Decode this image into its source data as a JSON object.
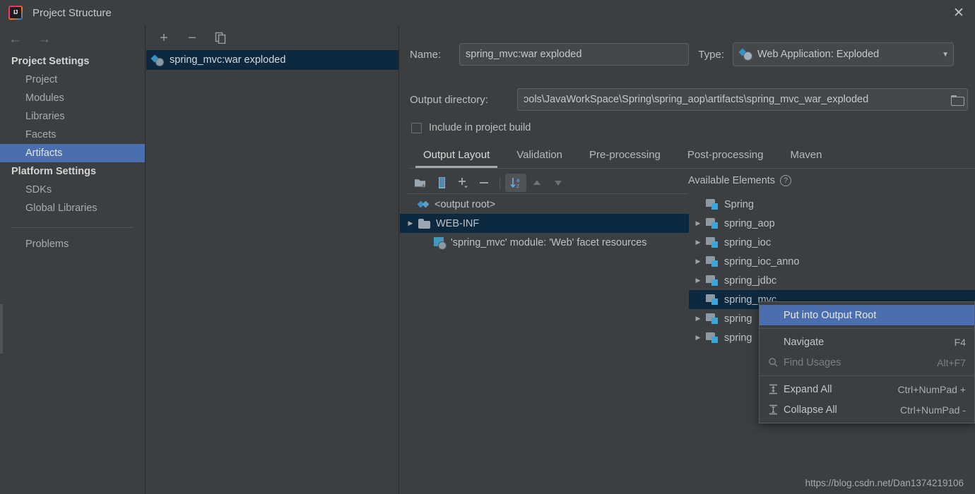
{
  "window": {
    "title": "Project Structure",
    "app_icon": "intellij-idea-logo",
    "close_icon": "✕"
  },
  "navigation": {
    "back_icon": "←",
    "forward_icon": "→"
  },
  "sidebar": {
    "groups": [
      {
        "label": "Project Settings",
        "items": [
          {
            "label": "Project",
            "selected": false
          },
          {
            "label": "Modules",
            "selected": false
          },
          {
            "label": "Libraries",
            "selected": false
          },
          {
            "label": "Facets",
            "selected": false
          },
          {
            "label": "Artifacts",
            "selected": true
          }
        ]
      },
      {
        "label": "Platform Settings",
        "items": [
          {
            "label": "SDKs",
            "selected": false
          },
          {
            "label": "Global Libraries",
            "selected": false
          }
        ]
      }
    ],
    "extra": {
      "label": "Problems"
    }
  },
  "artifacts_panel": {
    "toolbar": [
      {
        "name": "add-artifact-button",
        "glyph": "+"
      },
      {
        "name": "remove-artifact-button",
        "glyph": "−"
      },
      {
        "name": "copy-artifact-button",
        "glyph": "❐"
      }
    ],
    "items": [
      {
        "label": "spring_mvc:war exploded",
        "icon": "artifact-webapp-icon",
        "selected": true
      }
    ]
  },
  "details": {
    "name_label": "Name:",
    "name_value": "spring_mvc:war exploded",
    "type_label": "Type:",
    "type_value": "Web Application: Exploded",
    "type_icon": "web-application-icon",
    "type_caret": "▼",
    "output_dir_label": "Output directory:",
    "output_dir_value": "ɔols\\JavaWorkSpace\\Spring\\spring_aop\\artifacts\\spring_mvc_war_exploded",
    "browse_icon": "folder-browse-icon",
    "include_in_build_label": "Include in project build",
    "include_in_build_checked": false,
    "tabs": [
      {
        "label": "Output Layout",
        "active": true
      },
      {
        "label": "Validation",
        "active": false
      },
      {
        "label": "Pre-processing",
        "active": false
      },
      {
        "label": "Post-processing",
        "active": false
      },
      {
        "label": "Maven",
        "active": false
      }
    ]
  },
  "layout_toolbar": {
    "buttons": [
      {
        "name": "create-directory-button",
        "icon": "new-folder-icon",
        "active": false,
        "disabled": false
      },
      {
        "name": "create-archive-button",
        "icon": "archive-icon",
        "active": false,
        "disabled": false
      },
      {
        "name": "add-copy-of-button",
        "icon": "plus-dropdown-icon",
        "active": false,
        "disabled": false
      },
      {
        "name": "remove-element-button",
        "icon": "minus-icon",
        "active": false,
        "disabled": false
      },
      {
        "name": "sort-alphabetically-button",
        "icon": "sort-az-icon",
        "active": true,
        "disabled": false
      },
      {
        "name": "move-up-button",
        "icon": "arrow-up-icon",
        "active": false,
        "disabled": true
      },
      {
        "name": "move-down-button",
        "icon": "arrow-down-icon",
        "active": false,
        "disabled": true
      }
    ]
  },
  "output_tree": [
    {
      "label": "<output root>",
      "icon": "output-root-icon",
      "indent": 0,
      "twisty": "",
      "selected": false
    },
    {
      "label": "WEB-INF",
      "icon": "folder-icon",
      "indent": 0,
      "twisty": "▶",
      "selected": true
    },
    {
      "label": "'spring_mvc' module: 'Web' facet resources",
      "icon": "web-facet-icon",
      "indent": 1,
      "twisty": "",
      "selected": false
    }
  ],
  "available_elements": {
    "header": "Available Elements",
    "help_icon": "?",
    "items": [
      {
        "label": "Spring",
        "twisty": "",
        "selected": false
      },
      {
        "label": "spring_aop",
        "twisty": "▶",
        "selected": false
      },
      {
        "label": "spring_ioc",
        "twisty": "▶",
        "selected": false
      },
      {
        "label": "spring_ioc_anno",
        "twisty": "▶",
        "selected": false
      },
      {
        "label": "spring_jdbc",
        "twisty": "▶",
        "selected": false
      },
      {
        "label": "spring_mvc",
        "twisty": "",
        "selected": true
      },
      {
        "label": "spring",
        "twisty": "▶",
        "selected": false
      },
      {
        "label": "spring",
        "twisty": "▶",
        "selected": false
      }
    ]
  },
  "context_menu": {
    "items": [
      {
        "label": "Put into Output Root",
        "shortcut": "",
        "icon": "",
        "highlight": true,
        "disabled": false,
        "separator_after": true
      },
      {
        "label": "Navigate",
        "shortcut": "F4",
        "icon": "",
        "highlight": false,
        "disabled": false,
        "separator_after": false
      },
      {
        "label": "Find Usages",
        "shortcut": "Alt+F7",
        "icon": "search-icon",
        "highlight": false,
        "disabled": true,
        "separator_after": true
      },
      {
        "label": "Expand All",
        "shortcut": "Ctrl+NumPad +",
        "icon": "expand-all-icon",
        "highlight": false,
        "disabled": false,
        "separator_after": false
      },
      {
        "label": "Collapse All",
        "shortcut": "Ctrl+NumPad -",
        "icon": "collapse-all-icon",
        "highlight": false,
        "disabled": false,
        "separator_after": false
      }
    ]
  },
  "watermark": {
    "text": "https://blog.csdn.net/Dan1374219106"
  },
  "colors": {
    "background": "#3c3f41",
    "selection_blue": "#4b6eaf",
    "tree_selection_navy": "#0d293f",
    "accent_blue": "#3592c4",
    "text": "#bbbbbb"
  }
}
